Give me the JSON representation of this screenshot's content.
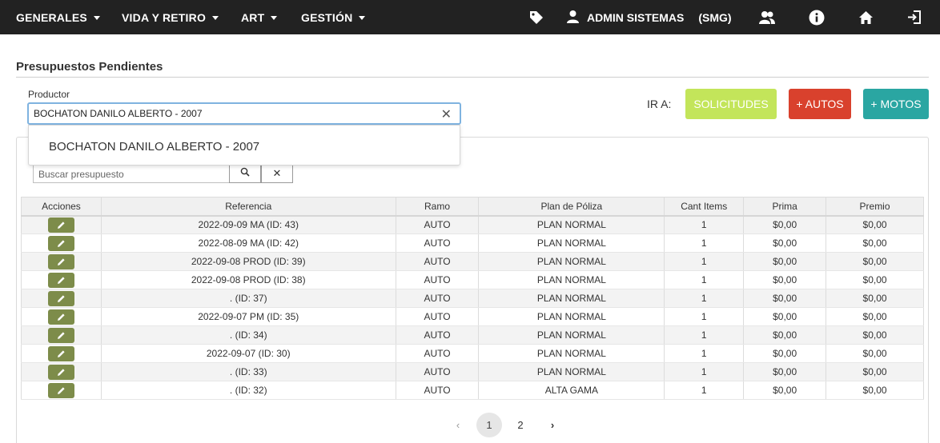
{
  "nav": {
    "menus": [
      "GENERALES",
      "VIDA Y RETIRO",
      "ART",
      "GESTIÓN"
    ],
    "user_name": "ADMIN SISTEMAS",
    "user_org": "(SMG)",
    "icons": [
      "tag-icon",
      "user-icon",
      "users-icon",
      "info-icon",
      "home-icon",
      "logout-icon"
    ]
  },
  "page": {
    "title": "Presupuestos Pendientes"
  },
  "productor": {
    "label": "Productor",
    "value": "BOCHATON DANILO ALBERTO - 2007",
    "clear_glyph": "✕",
    "dropdown_option": "BOCHATON DANILO ALBERTO - 2007"
  },
  "ir_a": {
    "label": "IR A:",
    "solicitudes": "SOLICITUDES",
    "autos": "+ AUTOS",
    "motos": "+ MOTOS"
  },
  "colors": {
    "navbar": "#222222",
    "solicitudes": "#c3e55a",
    "autos": "#d9412d",
    "motos": "#2aa6a2",
    "edit_button": "#7d8c4a"
  },
  "search": {
    "placeholder": "Buscar presupuesto",
    "clear_glyph": "✕"
  },
  "table": {
    "headers": [
      "Acciones",
      "Referencia",
      "Ramo",
      "Plan de Póliza",
      "Cant Items",
      "Prima",
      "Premio"
    ],
    "rows": [
      {
        "referencia": "2022-09-09 MA (ID: 43)",
        "ramo": "AUTO",
        "plan": "PLAN NORMAL",
        "items": "1",
        "prima": "$0,00",
        "premio": "$0,00"
      },
      {
        "referencia": "2022-08-09 MA (ID: 42)",
        "ramo": "AUTO",
        "plan": "PLAN NORMAL",
        "items": "1",
        "prima": "$0,00",
        "premio": "$0,00"
      },
      {
        "referencia": "2022-09-08 PROD (ID: 39)",
        "ramo": "AUTO",
        "plan": "PLAN NORMAL",
        "items": "1",
        "prima": "$0,00",
        "premio": "$0,00"
      },
      {
        "referencia": "2022-09-08 PROD (ID: 38)",
        "ramo": "AUTO",
        "plan": "PLAN NORMAL",
        "items": "1",
        "prima": "$0,00",
        "premio": "$0,00"
      },
      {
        "referencia": ". (ID: 37)",
        "ramo": "AUTO",
        "plan": "PLAN NORMAL",
        "items": "1",
        "prima": "$0,00",
        "premio": "$0,00"
      },
      {
        "referencia": "2022-09-07 PM (ID: 35)",
        "ramo": "AUTO",
        "plan": "PLAN NORMAL",
        "items": "1",
        "prima": "$0,00",
        "premio": "$0,00"
      },
      {
        "referencia": ". (ID: 34)",
        "ramo": "AUTO",
        "plan": "PLAN NORMAL",
        "items": "1",
        "prima": "$0,00",
        "premio": "$0,00"
      },
      {
        "referencia": "2022-09-07 (ID: 30)",
        "ramo": "AUTO",
        "plan": "PLAN NORMAL",
        "items": "1",
        "prima": "$0,00",
        "premio": "$0,00"
      },
      {
        "referencia": ". (ID: 33)",
        "ramo": "AUTO",
        "plan": "PLAN NORMAL",
        "items": "1",
        "prima": "$0,00",
        "premio": "$0,00"
      },
      {
        "referencia": ". (ID: 32)",
        "ramo": "AUTO",
        "plan": "ALTA GAMA",
        "items": "1",
        "prima": "$0,00",
        "premio": "$0,00"
      }
    ]
  },
  "pagination": {
    "prev": "‹",
    "pages": [
      "1",
      "2"
    ],
    "next": "›",
    "current": "1"
  }
}
